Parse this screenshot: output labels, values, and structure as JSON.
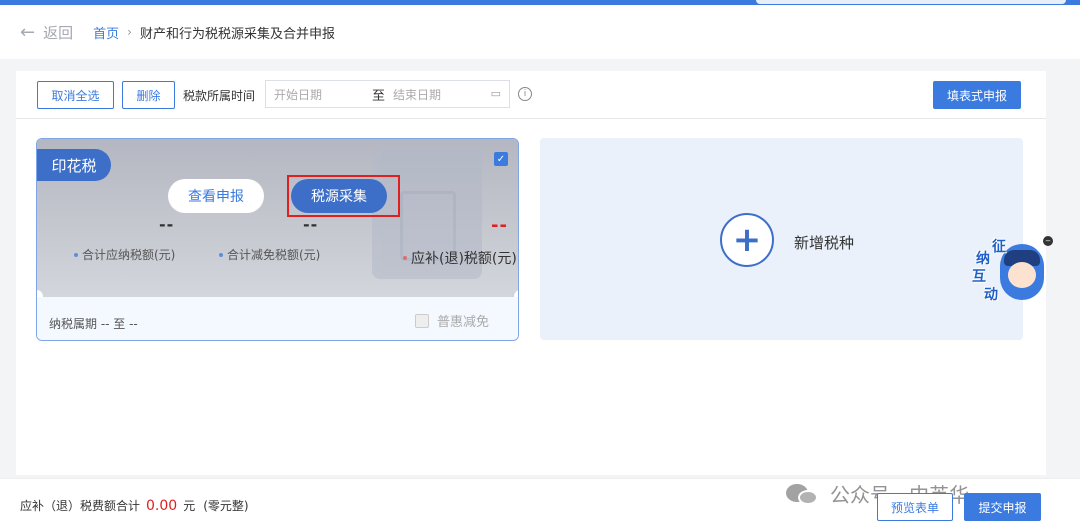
{
  "header": {
    "back_label": "返回",
    "breadcrumb_home": "首页",
    "breadcrumb_separator": "›",
    "breadcrumb_current": "财产和行为税税源采集及合并申报"
  },
  "toolbar": {
    "cancel_select_all": "取消全选",
    "delete": "删除",
    "period_label": "税款所属时间",
    "start_placeholder": "开始日期",
    "range_to": "至",
    "end_placeholder": "结束日期",
    "form_declare": "填表式申报"
  },
  "tax_card": {
    "name": "印花税",
    "checked": true,
    "view_declare": "查看申报",
    "source_collect": "税源采集",
    "payable_value": "--",
    "payable_label": "合计应纳税额(元)",
    "relief_value": "--",
    "relief_label": "合计减免税额(元)",
    "refund_value": "--",
    "refund_label": "应补(退)税额(元)",
    "period_text": "纳税属期 -- 至 --",
    "preferential_label": "普惠减免"
  },
  "add_card": {
    "label": "新增税种"
  },
  "assistant": {
    "chars": [
      "征",
      "纳",
      "互",
      "动"
    ]
  },
  "footer": {
    "total_label": "应补（退）税费额合计",
    "total_amount": "0.00",
    "total_unit": "元",
    "total_words": "(零元整)",
    "watermark": "公众号 · 中英华",
    "preview": "预览表单",
    "submit": "提交申报"
  },
  "colors": {
    "accent": "#3b7be0",
    "badge": "#3d6fc9",
    "highlight_box": "#e02020",
    "negative_amount": "#e02020"
  },
  "icons": {
    "back": "arrow-left-icon",
    "calendar": "calendar-icon",
    "info": "info-icon",
    "check": "checkbox-checked-icon",
    "add": "plus-circle-icon"
  }
}
